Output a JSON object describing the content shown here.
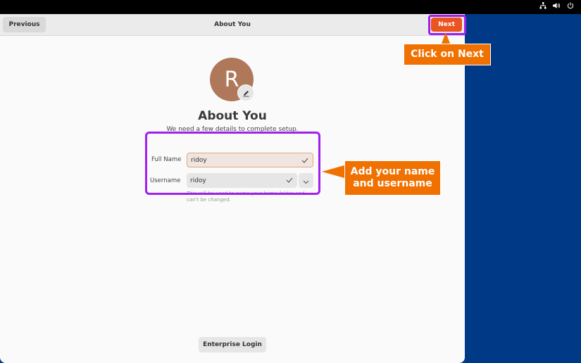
{
  "headerbar": {
    "previous_label": "Previous",
    "title": "About You",
    "next_label": "Next"
  },
  "avatar": {
    "initial": "R"
  },
  "page": {
    "heading": "About You",
    "subtitle": "We need a few details to complete setup."
  },
  "form": {
    "full_name_label": "Full Name",
    "full_name_value": "ridoy",
    "username_label": "Username",
    "username_value": "ridoy",
    "username_hint": "This will be used to name your home folder and can't be changed."
  },
  "footer": {
    "enterprise_label": "Enterprise Login"
  },
  "annotations": {
    "next_callout": "Click on Next",
    "form_callout": "Add your name and username"
  },
  "colors": {
    "accent": "#e95420",
    "highlight": "#a020f0",
    "callout": "#f07000",
    "desktop": "#003a87",
    "avatar": "#b0785b"
  },
  "icons": {
    "tray": [
      "network-icon",
      "volume-icon",
      "power-icon"
    ],
    "avatar_edit": "pencil-icon",
    "field_status": "check-icon",
    "dropdown": "chevron-down-icon"
  }
}
